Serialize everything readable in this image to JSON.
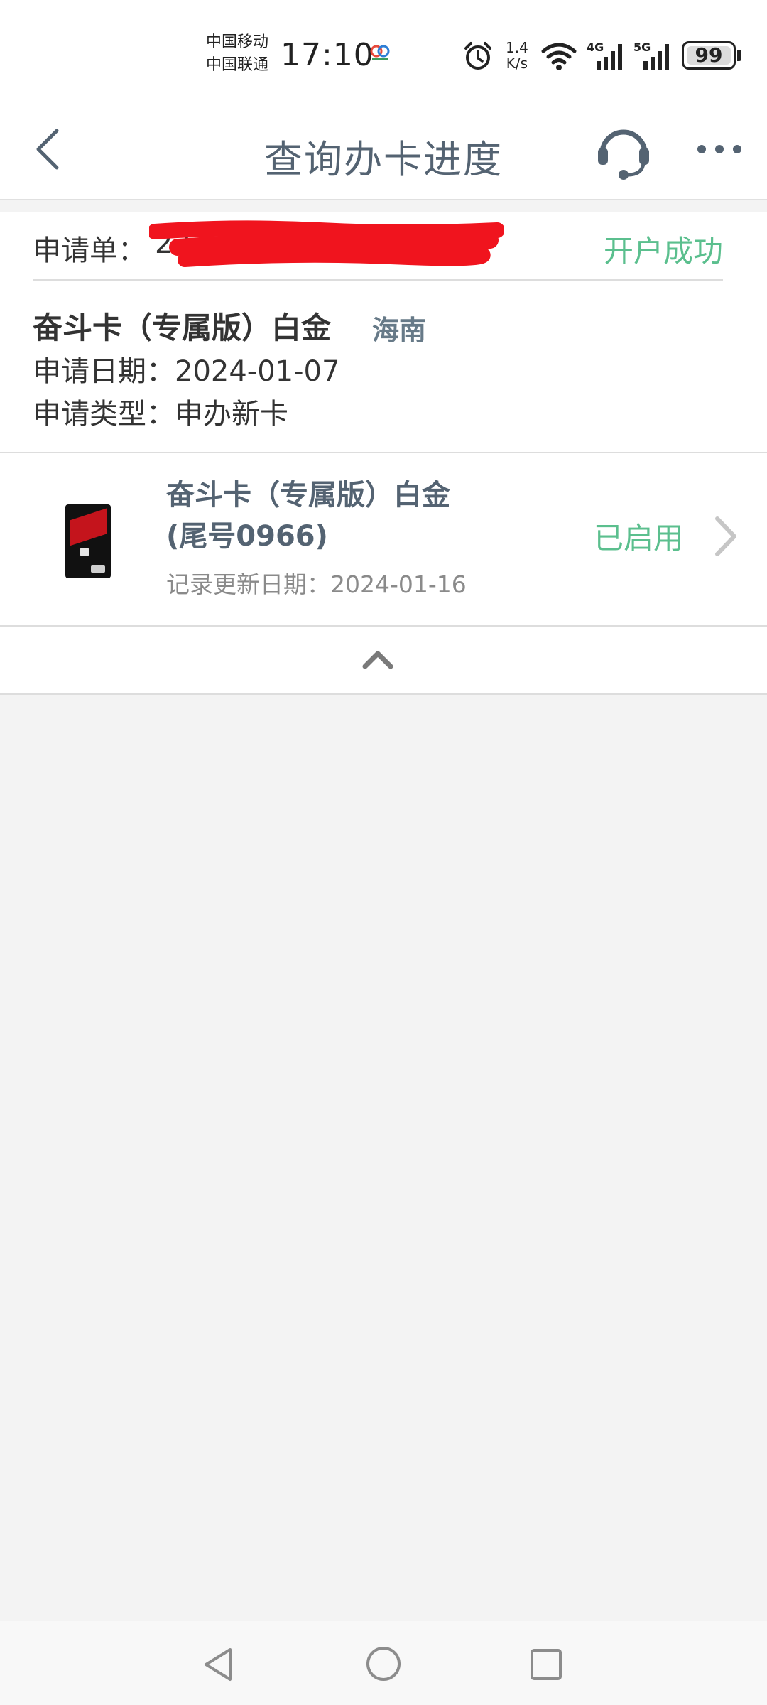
{
  "status_bar": {
    "carrier_top": "中国移动",
    "carrier_bottom": "中国联通",
    "time": "17:10",
    "net_speed_value": "1.4",
    "net_speed_unit": "K/s",
    "signal_4g": "4G",
    "signal_5g": "5G",
    "battery": "99"
  },
  "header": {
    "title": "查询办卡进度"
  },
  "application": {
    "order_label": "申请单：",
    "order_number": "22",
    "status": "开户成功",
    "card_name": "奋斗卡（专属版）白金",
    "region": "海南",
    "apply_date": "申请日期：2024-01-07",
    "apply_type": "申请类型：申办新卡"
  },
  "card": {
    "title_line1": "奋斗卡（专属版）白金",
    "title_line2": "(尾号0966)",
    "updated": "记录更新日期：2024-01-16",
    "status": "已启用"
  },
  "colors": {
    "accent_green": "#5bbf8e",
    "title_gray": "#546372",
    "redaction": "#f0141e",
    "background": "#f3f3f3"
  },
  "icons": [
    "back-arrow-icon",
    "headset-icon",
    "more-icon",
    "chevron-right-icon",
    "chevron-up-icon"
  ]
}
